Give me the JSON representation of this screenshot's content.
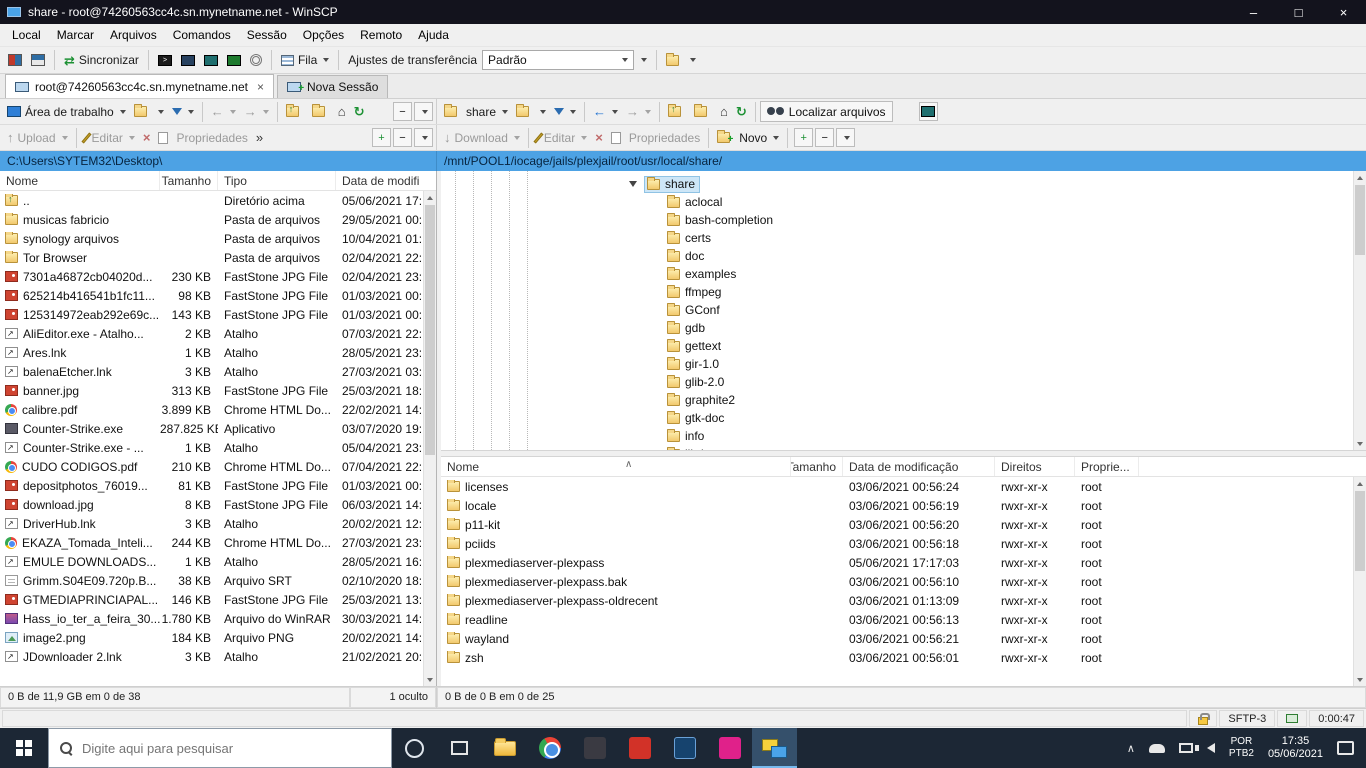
{
  "window": {
    "title": "share - root@74260563cc4c.sn.mynetname.net - WinSCP",
    "controls": {
      "minimize": "–",
      "maximize": "□",
      "close": "×"
    }
  },
  "menu": [
    "Local",
    "Marcar",
    "Arquivos",
    "Comandos",
    "Sessão",
    "Opções",
    "Remoto",
    "Ajuda"
  ],
  "glyphs": {
    "back": "←",
    "forward": "→",
    "parent_up": "↑",
    "home": "⌂",
    "refresh": "↻",
    "overflow": "»",
    "delete": "×",
    "plus": "+",
    "minus": "−",
    "upload": "↑",
    "download": "↓",
    "sync": "⇄",
    "chevron_up": "∧",
    "console_prompt": ">"
  },
  "toolbar": {
    "sincronizar": "Sincronizar",
    "fila": "Fila",
    "transfer_label": "Ajustes de transferência",
    "transfer_value": "Padrão"
  },
  "tabs": {
    "session_label": "root@74260563cc4c.sn.mynetname.net",
    "new_session_label": "Nova Sessão"
  },
  "left_panel": {
    "drive_label": "Área de trabalho",
    "path": "C:\\Users\\SYTEM32\\Desktop\\",
    "commands": {
      "upload": "Upload",
      "editar": "Editar",
      "propriedades": "Propriedades"
    },
    "columns": [
      "Nome",
      "Tamanho",
      "Tipo",
      "Data de modifi"
    ],
    "files": [
      {
        "icon": "folder-up",
        "name": "..",
        "size": "",
        "type": "Diretório acima",
        "date": "05/06/2021 17:"
      },
      {
        "icon": "folder",
        "name": "musicas fabricio",
        "size": "",
        "type": "Pasta de arquivos",
        "date": "29/05/2021 00:"
      },
      {
        "icon": "folder",
        "name": "synology arquivos",
        "size": "",
        "type": "Pasta de arquivos",
        "date": "10/04/2021 01:"
      },
      {
        "icon": "folder",
        "name": "Tor Browser",
        "size": "",
        "type": "Pasta de arquivos",
        "date": "02/04/2021 22:"
      },
      {
        "icon": "jpg",
        "name": "7301a46872cb04020d...",
        "size": "230 KB",
        "type": "FastStone JPG File",
        "date": "02/04/2021 23:"
      },
      {
        "icon": "jpg",
        "name": "625214b416541b1fc11...",
        "size": "98 KB",
        "type": "FastStone JPG File",
        "date": "01/03/2021 00:"
      },
      {
        "icon": "jpg",
        "name": "125314972eab292e69c...",
        "size": "143 KB",
        "type": "FastStone JPG File",
        "date": "01/03/2021 00:"
      },
      {
        "icon": "link",
        "name": "AliEditor.exe - Atalho...",
        "size": "2 KB",
        "type": "Atalho",
        "date": "07/03/2021 22:"
      },
      {
        "icon": "link",
        "name": "Ares.lnk",
        "size": "1 KB",
        "type": "Atalho",
        "date": "28/05/2021 23:"
      },
      {
        "icon": "link",
        "name": "balenaEtcher.lnk",
        "size": "3 KB",
        "type": "Atalho",
        "date": "27/03/2021 03:"
      },
      {
        "icon": "jpg",
        "name": "banner.jpg",
        "size": "313 KB",
        "type": "FastStone JPG File",
        "date": "25/03/2021 18:"
      },
      {
        "icon": "chrome",
        "name": "calibre.pdf",
        "size": "3.899 KB",
        "type": "Chrome HTML Do...",
        "date": "22/02/2021 14:"
      },
      {
        "icon": "app",
        "name": "Counter-Strike.exe",
        "size": "287.825 KB",
        "type": "Aplicativo",
        "date": "03/07/2020 19:"
      },
      {
        "icon": "link",
        "name": "Counter-Strike.exe - ...",
        "size": "1 KB",
        "type": "Atalho",
        "date": "05/04/2021 23:"
      },
      {
        "icon": "chrome",
        "name": "CUDO CODIGOS.pdf",
        "size": "210 KB",
        "type": "Chrome HTML Do...",
        "date": "07/04/2021 22:"
      },
      {
        "icon": "jpg",
        "name": "depositphotos_76019...",
        "size": "81 KB",
        "type": "FastStone JPG File",
        "date": "01/03/2021 00:"
      },
      {
        "icon": "jpg",
        "name": "download.jpg",
        "size": "8 KB",
        "type": "FastStone JPG File",
        "date": "06/03/2021 14:"
      },
      {
        "icon": "link",
        "name": "DriverHub.lnk",
        "size": "3 KB",
        "type": "Atalho",
        "date": "20/02/2021 12:"
      },
      {
        "icon": "chrome",
        "name": "EKAZA_Tomada_Inteli...",
        "size": "244 KB",
        "type": "Chrome HTML Do...",
        "date": "27/03/2021 23:"
      },
      {
        "icon": "link",
        "name": "EMULE DOWNLOADS...",
        "size": "1 KB",
        "type": "Atalho",
        "date": "28/05/2021 16:"
      },
      {
        "icon": "srt",
        "name": "Grimm.S04E09.720p.B...",
        "size": "38 KB",
        "type": "Arquivo SRT",
        "date": "02/10/2020 18:"
      },
      {
        "icon": "jpg",
        "name": "GTMEDIAPRINCIAPAL...",
        "size": "146 KB",
        "type": "FastStone JPG File",
        "date": "25/03/2021 13:"
      },
      {
        "icon": "rar",
        "name": "Hass_io_ter_a_feira_30...",
        "size": "1.780 KB",
        "type": "Arquivo do WinRAR",
        "date": "30/03/2021 14:"
      },
      {
        "icon": "png",
        "name": "image2.png",
        "size": "184 KB",
        "type": "Arquivo PNG",
        "date": "20/02/2021 14:"
      },
      {
        "icon": "link",
        "name": "JDownloader 2.lnk",
        "size": "3 KB",
        "type": "Atalho",
        "date": "21/02/2021 20:"
      }
    ],
    "status_main": "0 B de 11,9 GB em 0 de 38",
    "status_hidden": "1 oculto"
  },
  "right_panel": {
    "drive_label": "share",
    "find_label": "Localizar arquivos",
    "path": "/mnt/POOL1/iocage/jails/plexjail/root/usr/local/share/",
    "commands": {
      "download": "Download",
      "editar": "Editar",
      "propriedades": "Propriedades",
      "novo": "Novo"
    },
    "tree": {
      "root": "share",
      "children": [
        "aclocal",
        "bash-completion",
        "certs",
        "doc",
        "examples",
        "ffmpeg",
        "GConf",
        "gdb",
        "gettext",
        "gir-1.0",
        "glib-2.0",
        "graphite2",
        "gtk-doc",
        "info",
        "libdrm"
      ]
    },
    "columns": [
      "Nome",
      "Tamanho",
      "Data de modificação",
      "Direitos",
      "Proprie..."
    ],
    "files": [
      {
        "name": "licenses",
        "date": "03/06/2021 00:56:24",
        "rights": "rwxr-xr-x",
        "owner": "root"
      },
      {
        "name": "locale",
        "date": "03/06/2021 00:56:19",
        "rights": "rwxr-xr-x",
        "owner": "root"
      },
      {
        "name": "p11-kit",
        "date": "03/06/2021 00:56:20",
        "rights": "rwxr-xr-x",
        "owner": "root"
      },
      {
        "name": "pciids",
        "date": "03/06/2021 00:56:18",
        "rights": "rwxr-xr-x",
        "owner": "root"
      },
      {
        "name": "plexmediaserver-plexpass",
        "date": "05/06/2021 17:17:03",
        "rights": "rwxr-xr-x",
        "owner": "root"
      },
      {
        "name": "plexmediaserver-plexpass.bak",
        "date": "03/06/2021 00:56:10",
        "rights": "rwxr-xr-x",
        "owner": "root"
      },
      {
        "name": "plexmediaserver-plexpass-oldrecent",
        "date": "03/06/2021 01:13:09",
        "rights": "rwxr-xr-x",
        "owner": "root"
      },
      {
        "name": "readline",
        "date": "03/06/2021 00:56:13",
        "rights": "rwxr-xr-x",
        "owner": "root"
      },
      {
        "name": "wayland",
        "date": "03/06/2021 00:56:21",
        "rights": "rwxr-xr-x",
        "owner": "root"
      },
      {
        "name": "zsh",
        "date": "03/06/2021 00:56:01",
        "rights": "rwxr-xr-x",
        "owner": "root"
      }
    ],
    "status_main": "0 B de 0 B em 0 de 25"
  },
  "statusbar": {
    "protocol": "SFTP-3",
    "duration": "0:00:47"
  },
  "taskbar": {
    "search_placeholder": "Digite aqui para pesquisar",
    "language_line1": "POR",
    "language_line2": "PTB2",
    "time": "17:35",
    "date": "05/06/2021"
  }
}
